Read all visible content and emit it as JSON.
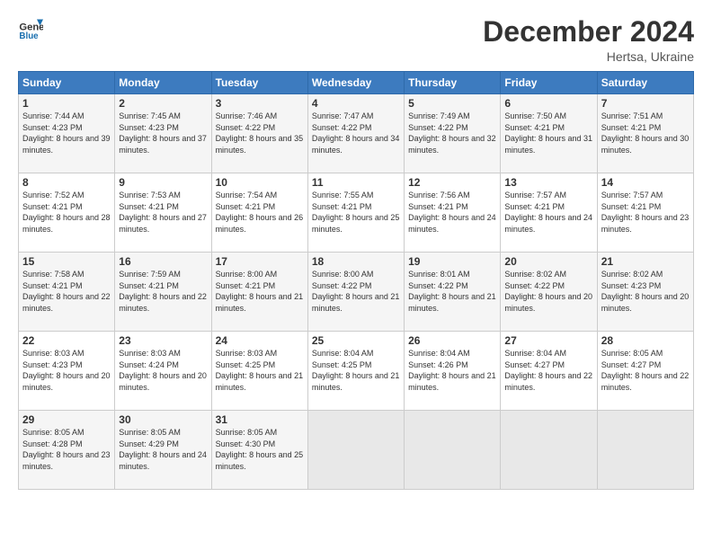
{
  "header": {
    "logo_line1": "General",
    "logo_line2": "Blue",
    "month": "December 2024",
    "location": "Hertsa, Ukraine"
  },
  "weekdays": [
    "Sunday",
    "Monday",
    "Tuesday",
    "Wednesday",
    "Thursday",
    "Friday",
    "Saturday"
  ],
  "weeks": [
    [
      {
        "day": "1",
        "sunrise": "7:44 AM",
        "sunset": "4:23 PM",
        "daylight": "8 hours and 39 minutes."
      },
      {
        "day": "2",
        "sunrise": "7:45 AM",
        "sunset": "4:23 PM",
        "daylight": "8 hours and 37 minutes."
      },
      {
        "day": "3",
        "sunrise": "7:46 AM",
        "sunset": "4:22 PM",
        "daylight": "8 hours and 35 minutes."
      },
      {
        "day": "4",
        "sunrise": "7:47 AM",
        "sunset": "4:22 PM",
        "daylight": "8 hours and 34 minutes."
      },
      {
        "day": "5",
        "sunrise": "7:49 AM",
        "sunset": "4:22 PM",
        "daylight": "8 hours and 32 minutes."
      },
      {
        "day": "6",
        "sunrise": "7:50 AM",
        "sunset": "4:21 PM",
        "daylight": "8 hours and 31 minutes."
      },
      {
        "day": "7",
        "sunrise": "7:51 AM",
        "sunset": "4:21 PM",
        "daylight": "8 hours and 30 minutes."
      }
    ],
    [
      {
        "day": "8",
        "sunrise": "7:52 AM",
        "sunset": "4:21 PM",
        "daylight": "8 hours and 28 minutes."
      },
      {
        "day": "9",
        "sunrise": "7:53 AM",
        "sunset": "4:21 PM",
        "daylight": "8 hours and 27 minutes."
      },
      {
        "day": "10",
        "sunrise": "7:54 AM",
        "sunset": "4:21 PM",
        "daylight": "8 hours and 26 minutes."
      },
      {
        "day": "11",
        "sunrise": "7:55 AM",
        "sunset": "4:21 PM",
        "daylight": "8 hours and 25 minutes."
      },
      {
        "day": "12",
        "sunrise": "7:56 AM",
        "sunset": "4:21 PM",
        "daylight": "8 hours and 24 minutes."
      },
      {
        "day": "13",
        "sunrise": "7:57 AM",
        "sunset": "4:21 PM",
        "daylight": "8 hours and 24 minutes."
      },
      {
        "day": "14",
        "sunrise": "7:57 AM",
        "sunset": "4:21 PM",
        "daylight": "8 hours and 23 minutes."
      }
    ],
    [
      {
        "day": "15",
        "sunrise": "7:58 AM",
        "sunset": "4:21 PM",
        "daylight": "8 hours and 22 minutes."
      },
      {
        "day": "16",
        "sunrise": "7:59 AM",
        "sunset": "4:21 PM",
        "daylight": "8 hours and 22 minutes."
      },
      {
        "day": "17",
        "sunrise": "8:00 AM",
        "sunset": "4:21 PM",
        "daylight": "8 hours and 21 minutes."
      },
      {
        "day": "18",
        "sunrise": "8:00 AM",
        "sunset": "4:22 PM",
        "daylight": "8 hours and 21 minutes."
      },
      {
        "day": "19",
        "sunrise": "8:01 AM",
        "sunset": "4:22 PM",
        "daylight": "8 hours and 21 minutes."
      },
      {
        "day": "20",
        "sunrise": "8:02 AM",
        "sunset": "4:22 PM",
        "daylight": "8 hours and 20 minutes."
      },
      {
        "day": "21",
        "sunrise": "8:02 AM",
        "sunset": "4:23 PM",
        "daylight": "8 hours and 20 minutes."
      }
    ],
    [
      {
        "day": "22",
        "sunrise": "8:03 AM",
        "sunset": "4:23 PM",
        "daylight": "8 hours and 20 minutes."
      },
      {
        "day": "23",
        "sunrise": "8:03 AM",
        "sunset": "4:24 PM",
        "daylight": "8 hours and 20 minutes."
      },
      {
        "day": "24",
        "sunrise": "8:03 AM",
        "sunset": "4:25 PM",
        "daylight": "8 hours and 21 minutes."
      },
      {
        "day": "25",
        "sunrise": "8:04 AM",
        "sunset": "4:25 PM",
        "daylight": "8 hours and 21 minutes."
      },
      {
        "day": "26",
        "sunrise": "8:04 AM",
        "sunset": "4:26 PM",
        "daylight": "8 hours and 21 minutes."
      },
      {
        "day": "27",
        "sunrise": "8:04 AM",
        "sunset": "4:27 PM",
        "daylight": "8 hours and 22 minutes."
      },
      {
        "day": "28",
        "sunrise": "8:05 AM",
        "sunset": "4:27 PM",
        "daylight": "8 hours and 22 minutes."
      }
    ],
    [
      {
        "day": "29",
        "sunrise": "8:05 AM",
        "sunset": "4:28 PM",
        "daylight": "8 hours and 23 minutes."
      },
      {
        "day": "30",
        "sunrise": "8:05 AM",
        "sunset": "4:29 PM",
        "daylight": "8 hours and 24 minutes."
      },
      {
        "day": "31",
        "sunrise": "8:05 AM",
        "sunset": "4:30 PM",
        "daylight": "8 hours and 25 minutes."
      },
      null,
      null,
      null,
      null
    ]
  ]
}
